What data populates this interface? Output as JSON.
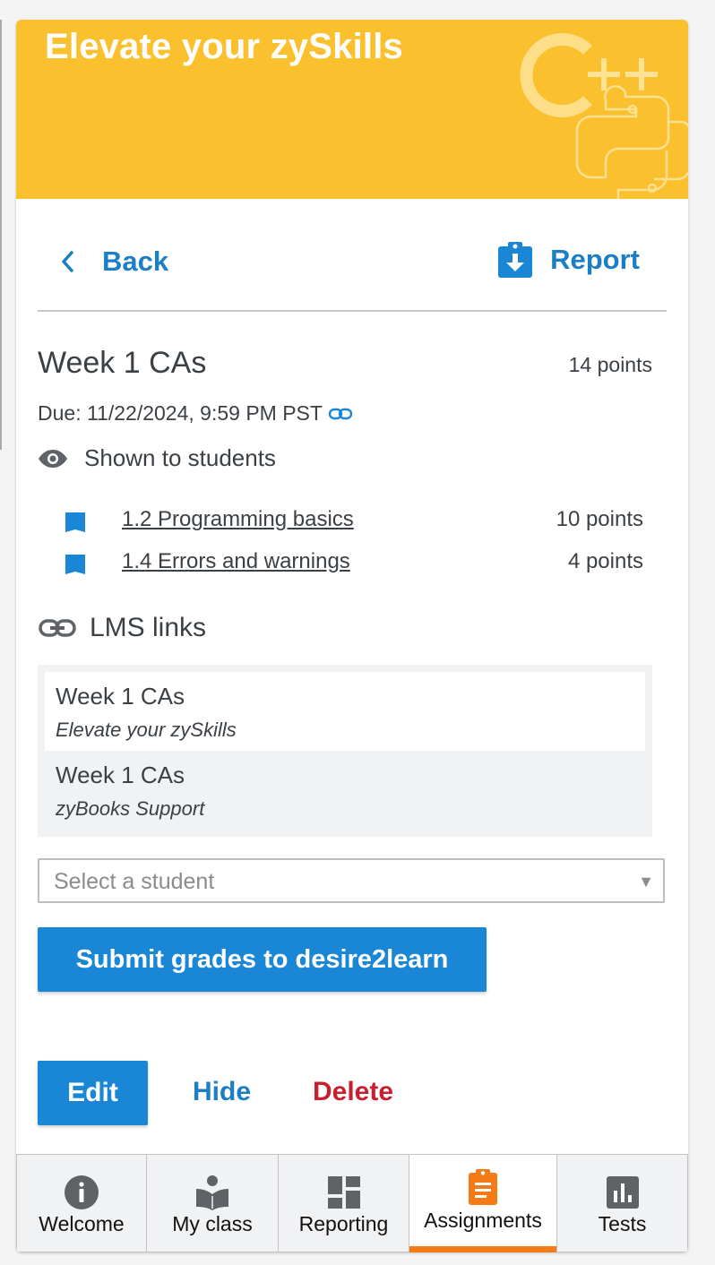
{
  "banner": {
    "title": "Elevate your zySkills"
  },
  "nav": {
    "back_label": "Back",
    "report_label": "Report"
  },
  "assignment": {
    "title": "Week 1 CAs",
    "points": "14 points",
    "due": "Due: 11/22/2024, 9:59 PM PST",
    "visibility": "Shown to students",
    "sections": [
      {
        "label": "1.2 Programming basics",
        "points": "10 points"
      },
      {
        "label": "1.4 Errors and warnings",
        "points": "4 points"
      }
    ]
  },
  "lms": {
    "heading": "LMS links",
    "links": [
      {
        "name": "Week 1 CAs",
        "course": "Elevate your zySkills"
      },
      {
        "name": "Week 1 CAs",
        "course": "zyBooks Support"
      }
    ]
  },
  "student_select": {
    "placeholder": "Select a student"
  },
  "actions": {
    "submit_label": "Submit grades to desire2learn",
    "edit_label": "Edit",
    "hide_label": "Hide",
    "delete_label": "Delete"
  },
  "tabs": [
    {
      "label": "Welcome",
      "icon": "info-icon"
    },
    {
      "label": "My class",
      "icon": "reader-icon"
    },
    {
      "label": "Reporting",
      "icon": "dashboard-icon"
    },
    {
      "label": "Assignments",
      "icon": "clipboard-icon"
    },
    {
      "label": "Tests",
      "icon": "bar-chart-icon"
    }
  ],
  "colors": {
    "banner": "#fbc02d",
    "primary": "#1a87d6",
    "link": "#1a7fc6",
    "danger": "#c8202f",
    "active_tab": "#f47b16"
  }
}
